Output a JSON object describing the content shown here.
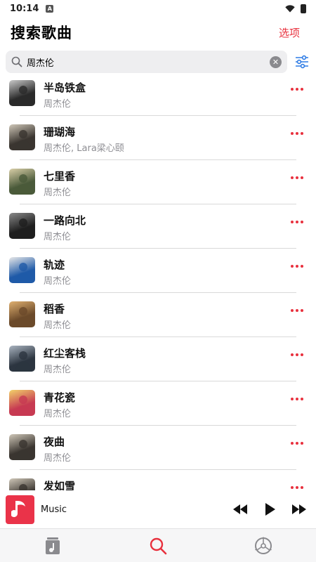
{
  "status_bar": {
    "time": "10:14",
    "notification_letter": "A"
  },
  "header": {
    "title": "搜索歌曲",
    "options_label": "选项"
  },
  "search": {
    "value": "周杰伦",
    "placeholder": ""
  },
  "songs": [
    {
      "title": "半岛铁盒",
      "artist": "周杰伦",
      "cover_color": "#2a2a2a",
      "cover_accent": "#c9c9c9"
    },
    {
      "title": "珊瑚海",
      "artist": "周杰伦, Lara梁心颐",
      "cover_color": "#3a3530",
      "cover_accent": "#cfc7b8"
    },
    {
      "title": "七里香",
      "artist": "周杰伦",
      "cover_color": "#4a5a3a",
      "cover_accent": "#d9cfa8"
    },
    {
      "title": "一路向北",
      "artist": "周杰伦",
      "cover_color": "#1e1e1e",
      "cover_accent": "#8a8a8a"
    },
    {
      "title": "轨迹",
      "artist": "周杰伦",
      "cover_color": "#1f5aa8",
      "cover_accent": "#e8e8e8"
    },
    {
      "title": "稻香",
      "artist": "周杰伦",
      "cover_color": "#6b4a2a",
      "cover_accent": "#e0b070"
    },
    {
      "title": "红尘客栈",
      "artist": "周杰伦",
      "cover_color": "#2c3540",
      "cover_accent": "#aab4c0"
    },
    {
      "title": "青花瓷",
      "artist": "周杰伦",
      "cover_color": "#c73a52",
      "cover_accent": "#f2d26a"
    },
    {
      "title": "夜曲",
      "artist": "周杰伦",
      "cover_color": "#3a3530",
      "cover_accent": "#cfc7b8"
    },
    {
      "title": "发如雪",
      "artist": "",
      "cover_color": "#3a3530",
      "cover_accent": "#cfc7b8"
    }
  ],
  "player": {
    "title": "Music",
    "accent": "#ea3349"
  },
  "colors": {
    "accent": "#e8313e",
    "secondary_text": "#8e8e93",
    "filter_blue": "#2d7be5"
  },
  "icons": {
    "tabs": [
      "library-icon",
      "search-icon",
      "settings-icon"
    ]
  }
}
